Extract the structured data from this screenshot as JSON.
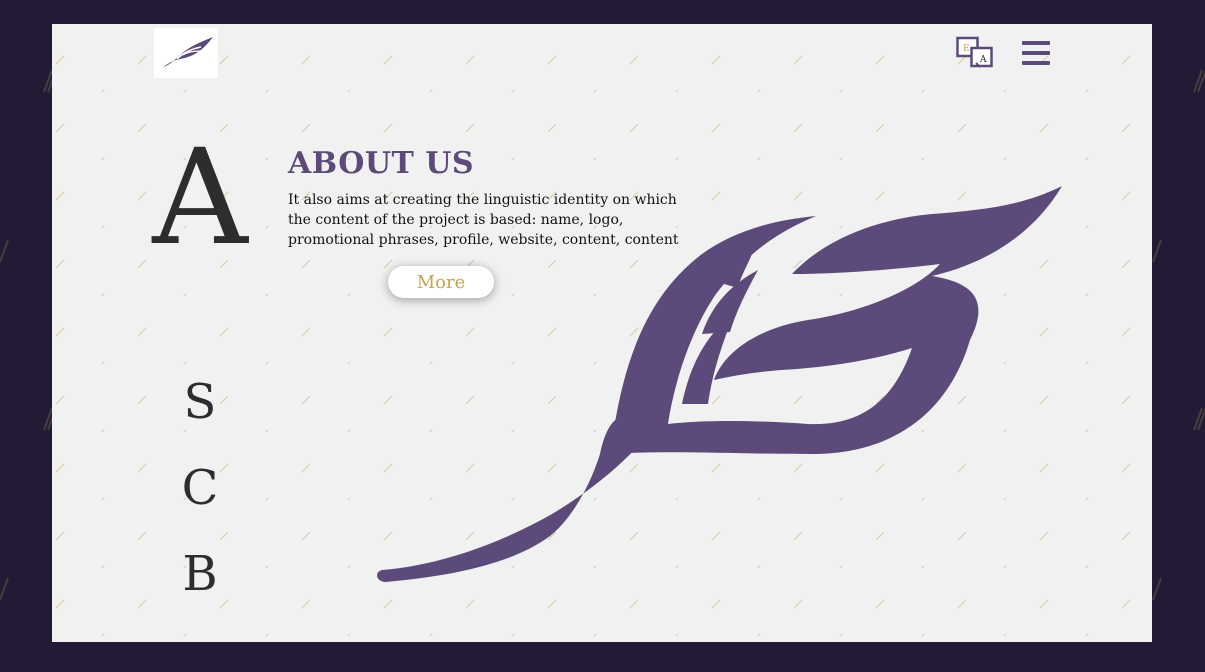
{
  "header": {
    "logo": {
      "caption": "",
      "icon": "feather-logo-icon"
    },
    "language_icon": {
      "name": "language-switch-icon",
      "letters": [
        "E",
        "A"
      ]
    },
    "menu_icon": "hamburger-menu-icon"
  },
  "letters": {
    "big": "A",
    "items": [
      "S",
      "C",
      "B"
    ]
  },
  "about": {
    "title": "ABOUT US",
    "description": "It also aims at creating the linguistic identity on which the content of the project is based: name, logo, promotional phrases, profile, website, content, content",
    "more_label": "More"
  },
  "colors": {
    "background": "#231b35",
    "panel": "#f1f1f1",
    "accent": "#5c4b7a",
    "gold": "#c7a24f",
    "text": "#2d2d2d"
  }
}
